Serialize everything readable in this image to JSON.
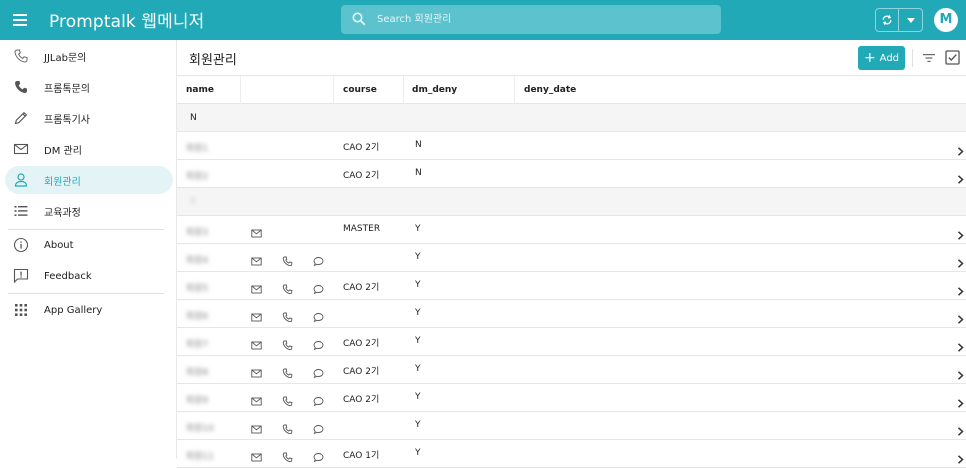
{
  "app": {
    "title": "Promptalk 웹메니저",
    "avatar_initial": "M",
    "accent_color": "#21a9b7"
  },
  "search": {
    "placeholder": "Search 회원관리"
  },
  "sidebar": {
    "items": [
      {
        "label": "JJLab문의",
        "icon": "phone-outline-icon"
      },
      {
        "label": "프롬톡문의",
        "icon": "phone-icon"
      },
      {
        "label": "프롬톡기사",
        "icon": "pencil-icon"
      },
      {
        "label": "DM 관리",
        "icon": "mail-icon"
      },
      {
        "label": "회원관리",
        "icon": "person-icon",
        "active": true
      },
      {
        "label": "교육과정",
        "icon": "list-icon"
      },
      {
        "label": "About",
        "icon": "info-icon"
      },
      {
        "label": "Feedback",
        "icon": "feedback-icon"
      },
      {
        "label": "App Gallery",
        "icon": "grid-icon"
      }
    ]
  },
  "main": {
    "title": "회원관리",
    "add_label": "Add",
    "columns": {
      "name": "name",
      "course": "course",
      "dm_deny": "dm_deny",
      "deny_date": "deny_date"
    },
    "groups": [
      {
        "label": "N",
        "blurred": false,
        "rows": [
          {
            "name": "회원1",
            "icons": [],
            "course": "CAO 2기",
            "dm_deny": "N"
          },
          {
            "name": "회원2",
            "icons": [],
            "course": "CAO 2기",
            "dm_deny": "N"
          }
        ]
      },
      {
        "label": "Y",
        "blurred": true,
        "rows": [
          {
            "name": "회원3",
            "icons": [
              "mail"
            ],
            "course": "MASTER",
            "dm_deny": "Y"
          },
          {
            "name": "회원4",
            "icons": [
              "mail",
              "phone",
              "chat"
            ],
            "course": "",
            "dm_deny": "Y"
          },
          {
            "name": "회원5",
            "icons": [
              "mail",
              "phone",
              "chat"
            ],
            "course": "CAO 2기",
            "dm_deny": "Y"
          },
          {
            "name": "회원6",
            "icons": [
              "mail",
              "phone",
              "chat"
            ],
            "course": "",
            "dm_deny": "Y"
          },
          {
            "name": "회원7",
            "icons": [
              "mail",
              "phone",
              "chat"
            ],
            "course": "CAO 2기",
            "dm_deny": "Y"
          },
          {
            "name": "회원8",
            "icons": [
              "mail",
              "phone",
              "chat"
            ],
            "course": "CAO 2기",
            "dm_deny": "Y"
          },
          {
            "name": "회원9",
            "icons": [
              "mail",
              "phone",
              "chat"
            ],
            "course": "CAO 2기",
            "dm_deny": "Y"
          },
          {
            "name": "회원10",
            "icons": [
              "mail",
              "phone",
              "chat"
            ],
            "course": "",
            "dm_deny": "Y"
          },
          {
            "name": "회원11",
            "icons": [
              "mail",
              "phone",
              "chat"
            ],
            "course": "CAO 1기",
            "dm_deny": "Y"
          }
        ]
      }
    ]
  }
}
